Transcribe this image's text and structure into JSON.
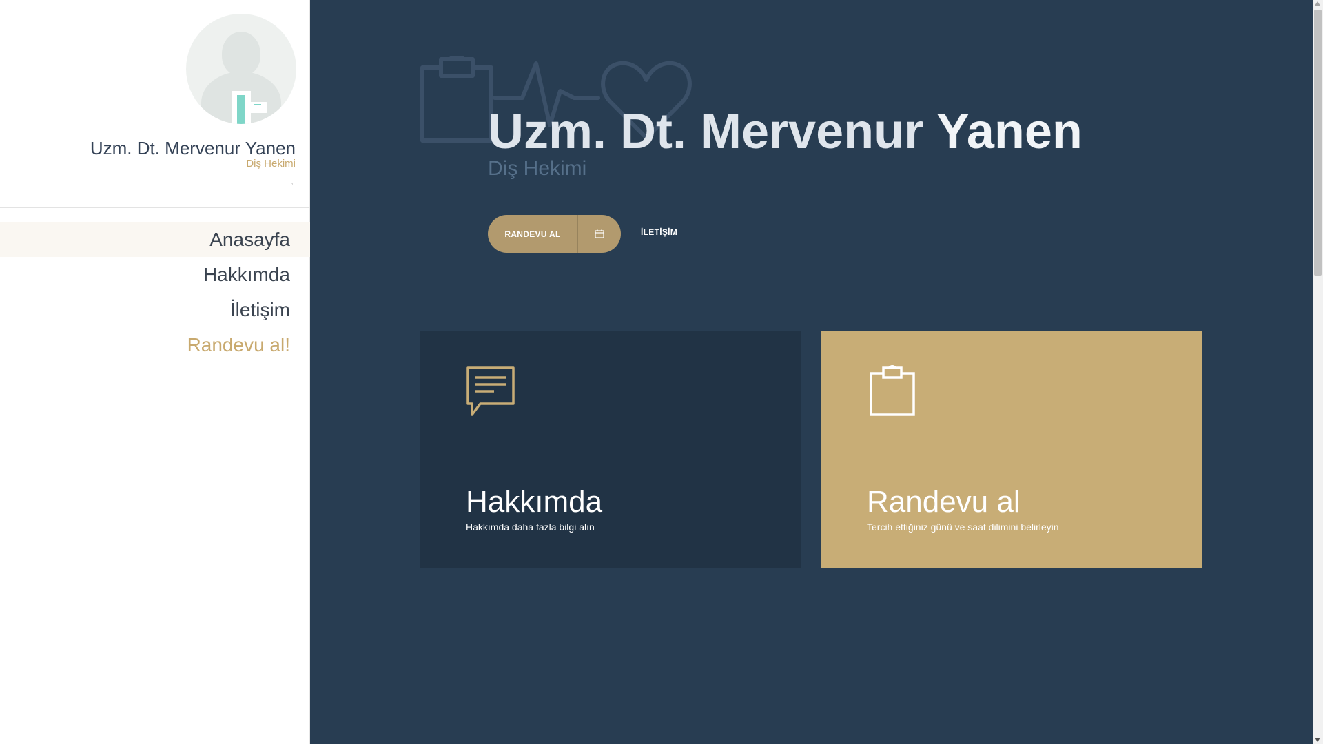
{
  "sidebar": {
    "profile": {
      "name": "Uzm. Dt. Mervenur Yanen",
      "title": "Diş Hekimi",
      "mini_icon": "▫"
    },
    "nav": [
      {
        "label": "Anasayfa",
        "active": true
      },
      {
        "label": "Hakkımda",
        "active": false
      },
      {
        "label": "İletişim",
        "active": false
      },
      {
        "label": "Randevu al!",
        "active": false,
        "highlight": true
      }
    ]
  },
  "hero": {
    "title_prefix": "Uzm. Dt. Mervenur ",
    "title_bold": "Yanen",
    "subtitle": "Diş Hekimi",
    "appointment_button": "RANDEVU AL",
    "contact_link": "İLETİŞİM",
    "background_icons": [
      "clipboard-icon",
      "heartbeat-icon",
      "heart-icon"
    ]
  },
  "cards": [
    {
      "title": "Hakkımda",
      "description": "Hakkımda daha fazla bilgi alın",
      "icon": "chat-bubble-icon"
    },
    {
      "title": "Randevu al",
      "description": "Tercih ettiğiniz günü ve saat dilimini belirleyin",
      "icon": "clipboard-icon"
    }
  ],
  "colors": {
    "main_bg": "#283d52",
    "card_dark": "#213345",
    "gold": "#c8ad76",
    "button_gold": "#b29a6e"
  }
}
